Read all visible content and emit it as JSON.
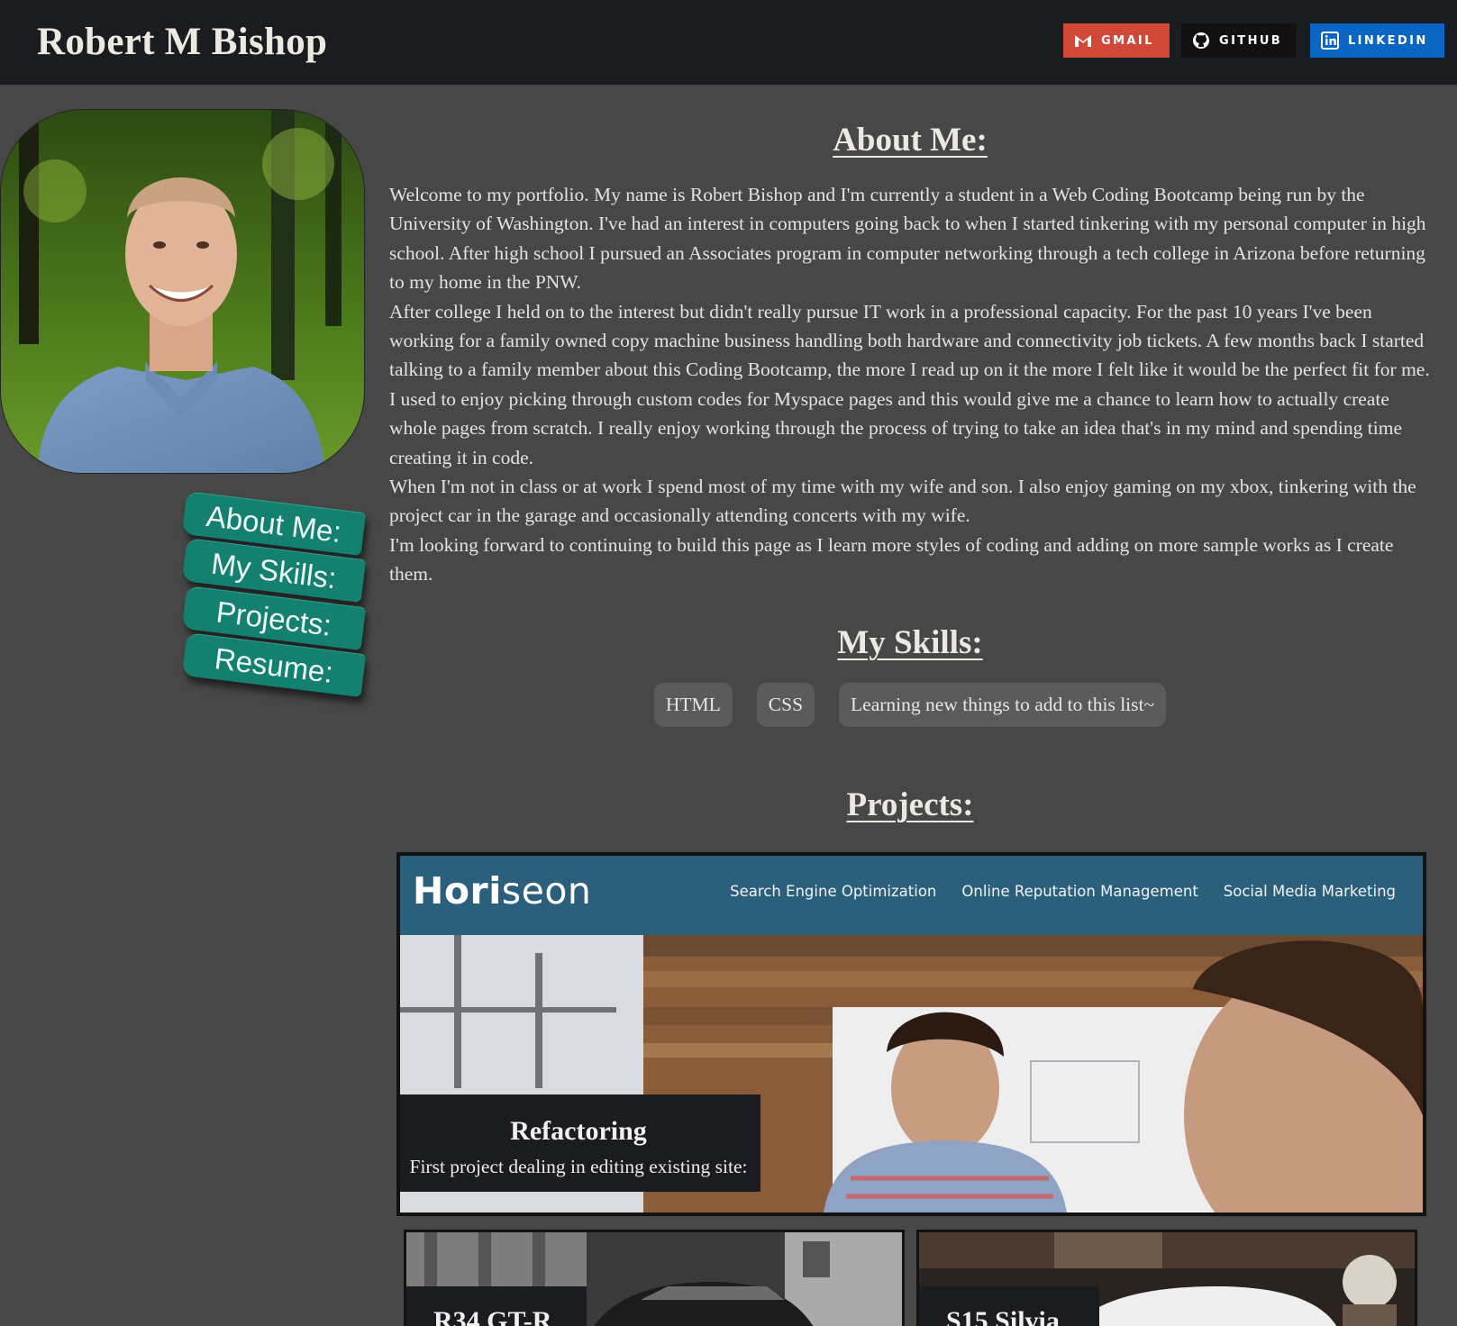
{
  "header": {
    "title": "Robert M Bishop",
    "links": [
      {
        "label": "GMAIL",
        "icon": "gmail-icon",
        "color": "#d14836"
      },
      {
        "label": "GITHUB",
        "icon": "github-icon",
        "color": "#121011"
      },
      {
        "label": "LINKEDIN",
        "icon": "linkedin-icon",
        "color": "#0a66c2"
      }
    ]
  },
  "side_nav": {
    "items": [
      "About Me:",
      "My Skills:",
      "Projects:",
      "Resume:"
    ],
    "color": "#14806f"
  },
  "about": {
    "title": "About Me:",
    "paragraphs": [
      "Welcome to my portfolio. My name is Robert Bishop and I'm currently a student in a Web Coding Bootcamp being run by the University of Washington. I've had an interest in computers going back to when I started tinkering with my personal computer in high school. After high school I pursued an Associates program in computer networking through a tech college in Arizona before returning to my home in the PNW.",
      "After college I held on to the interest but didn't really pursue IT work in a professional capacity. For the past 10 years I've been working for a family owned copy machine business handling both hardware and connectivity job tickets. A few months back I started talking to a family member about this Coding Bootcamp, the more I read up on it the more I felt like it would be the perfect fit for me. I used to enjoy picking through custom codes for Myspace pages and this would give me a chance to learn how to actually create whole pages from scratch. I really enjoy working through the process of trying to take an idea that's in my mind and spending time creating it in code.",
      "When I'm not in class or at work I spend most of my time with my wife and son. I also enjoy gaming on my xbox, tinkering with the project car in the garage and occasionally attending concerts with my wife.",
      "I'm looking forward to continuing to build this page as I learn more styles of coding and adding on more sample works as I create them."
    ]
  },
  "skills": {
    "title": "My Skills:",
    "items": [
      "HTML",
      "CSS",
      "Learning new things to add to this list~"
    ]
  },
  "projects": {
    "title": "Projects:",
    "featured": {
      "site_logo_bold": "Hori",
      "site_logo_light": "seon",
      "site_nav": [
        "Search Engine Optimization",
        "Online Reputation Management",
        "Social Media Marketing"
      ],
      "title": "Refactoring",
      "description": "First project dealing in editing existing site:"
    },
    "thumbnails": [
      {
        "title": "R34 GT-R"
      },
      {
        "title": "S15 Silvia"
      }
    ]
  }
}
